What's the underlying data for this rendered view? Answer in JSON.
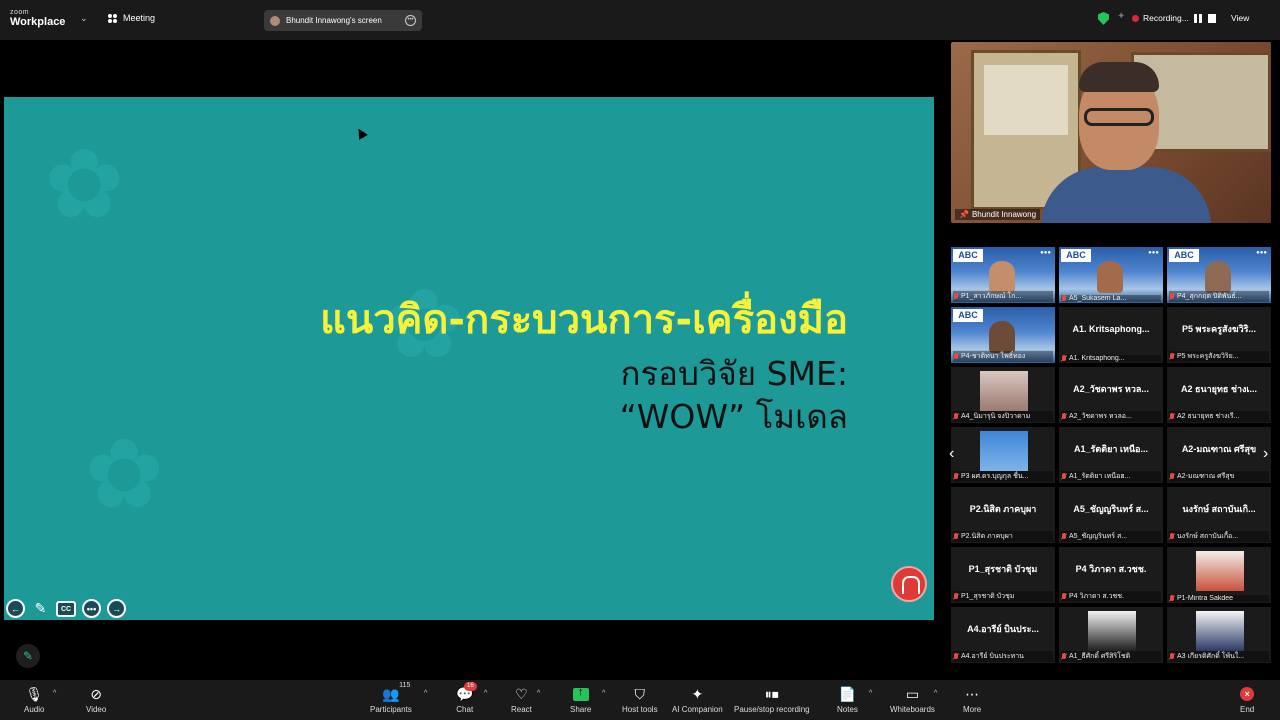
{
  "app": {
    "brand_small": "zoom",
    "brand_big": "Workplace",
    "meeting_label": "Meeting"
  },
  "screen_share": {
    "label": "Bhundit Innawong's screen"
  },
  "recording": {
    "label": "Recording..."
  },
  "view_label": "View",
  "slide": {
    "title": "แนวคิด-กระบวนการ-เครื่องมือ",
    "subtitle_line1": "กรอบวิจัย SME:",
    "subtitle_line2": "“WOW” โมเดล",
    "background_color": "#1d9a98",
    "title_color": "#f6f23a"
  },
  "slide_controls": [
    "prev-icon",
    "pen-icon",
    "cc-icon",
    "more-icon",
    "next-icon"
  ],
  "speaker": {
    "name": "Bhundit Innawong"
  },
  "gallery": {
    "tiles": [
      {
        "name": "",
        "label": "P1_สาวภักษณ์ โก..."
      },
      {
        "name": "",
        "label": "A5_Sukasem La..."
      },
      {
        "name": "",
        "label": "P4_สุกกฤต ปิติพันธ์..."
      },
      {
        "name": "",
        "label": "P4-ชาติทนา โพธิ์ทอง"
      },
      {
        "name": "A1. Kritsaphong...",
        "label": "A1. Kritsaphong..."
      },
      {
        "name": "P5 พระครูสังฆวิริ...",
        "label": "P5 พระครูสังฆวิริย..."
      },
      {
        "name": "",
        "label": "A4_นิมารุนิ จงปิวาดาม"
      },
      {
        "name": "A2_วัชดาพร หวล...",
        "label": "A2_วัชดาพร หวลอ..."
      },
      {
        "name": "A2 ธนายุทธ ช่างเ...",
        "label": "A2 ธนายุทธ ช่างเรี..."
      },
      {
        "name": "",
        "label": "P3 ผศ.ดร.บุญกุล ชื่น..."
      },
      {
        "name": "A1_รัตติยา เหนือ...",
        "label": "A1_รัตติยา เหนือฮ..."
      },
      {
        "name": "A2-มณฑาณ ศรีสุข",
        "label": "A2-มณฑาณ ศรีสุข"
      },
      {
        "name": "P2.นิสิต ภาคบุผา",
        "label": "P2.นิสิต ภาคบุผา"
      },
      {
        "name": "A5_ชัญญรินทร์ ส...",
        "label": "A5_ชัญญรินทร์ ส..."
      },
      {
        "name": "นงรักษ์ สถาบันเกิ...",
        "label": "นงรักษ์ สถาบันเกื้อ..."
      },
      {
        "name": "P1_สุรชาติ บัวชุม",
        "label": "P1_สุรชาติ บัวชุม"
      },
      {
        "name": "P4 วิภาดา ส.วชช.",
        "label": "P4 วิภาดา ส.วชช."
      },
      {
        "name": "",
        "label": "P1-Mintra Sakdee"
      },
      {
        "name": "A4.อารีย์ บินประ...",
        "label": "A4.อารีย์ บินประทาน"
      },
      {
        "name": "",
        "label": "A1_ธีศักดิ์ ศรีสิริโชติ"
      },
      {
        "name": "",
        "label": "A3 เกียรติศักดิ์ โพ้นใ..."
      }
    ]
  },
  "toolbar": {
    "audio": "Audio",
    "video": "Video",
    "participants": "Participants",
    "participants_count": "115",
    "chat": "Chat",
    "chat_badge": "16",
    "react": "React",
    "share": "Share",
    "host_tools": "Host tools",
    "ai_companion": "AI Companion",
    "pause_stop": "Pause/stop recording",
    "notes": "Notes",
    "whiteboards": "Whiteboards",
    "more": "More",
    "end": "End"
  },
  "colors": {
    "accent_green": "#27c25a",
    "end_red": "#e03a3a",
    "recording_red": "#e0243b"
  }
}
